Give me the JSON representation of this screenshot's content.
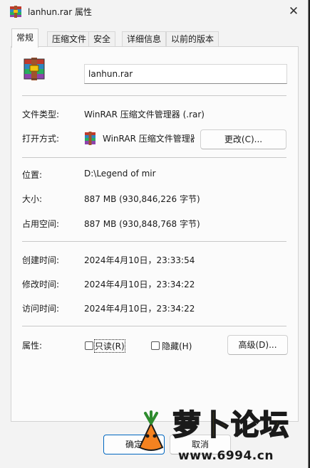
{
  "window": {
    "title": "lanhun.rar 属性",
    "close_glyph": "✕"
  },
  "tabs": [
    {
      "label": "常规",
      "active": true
    },
    {
      "label": "压缩文件",
      "active": false
    },
    {
      "label": "安全",
      "active": false
    },
    {
      "label": "详细信息",
      "active": false
    },
    {
      "label": "以前的版本",
      "active": false
    }
  ],
  "general": {
    "filename": "lanhun.rar",
    "file_type_label": "文件类型:",
    "file_type_value": "WinRAR 压缩文件管理器 (.rar)",
    "opens_with_label": "打开方式:",
    "opens_with_value": "WinRAR 压缩文件管理器",
    "change_button": "更改(C)...",
    "location_label": "位置:",
    "location_value": "D:\\Legend of mir",
    "size_label": "大小:",
    "size_value": "887 MB (930,846,226 字节)",
    "size_on_disk_label": "占用空间:",
    "size_on_disk_value": "887 MB (930,848,768 字节)",
    "created_label": "创建时间:",
    "created_value": "2024年4月10日，23:33:54",
    "modified_label": "修改时间:",
    "modified_value": "2024年4月10日，23:34:22",
    "accessed_label": "访问时间:",
    "accessed_value": "2024年4月10日，23:34:22",
    "attributes_label": "属性:",
    "readonly_label": "只读(R)",
    "readonly_checked": false,
    "hidden_label": "隐藏(H)",
    "hidden_checked": false,
    "advanced_button": "高级(D)..."
  },
  "footer": {
    "ok_button": "确定",
    "cancel_button": "取消"
  },
  "watermark": {
    "text": "萝卜论坛",
    "url": "www.6994.cn"
  },
  "icons": {
    "app": "winrar-archive-icon",
    "file": "winrar-archive-icon",
    "close": "close-icon"
  },
  "colors": {
    "window_bg": "#f3f3f3",
    "panel_bg": "#fbfbfb",
    "watermark_yellow": "#ffd21a"
  }
}
